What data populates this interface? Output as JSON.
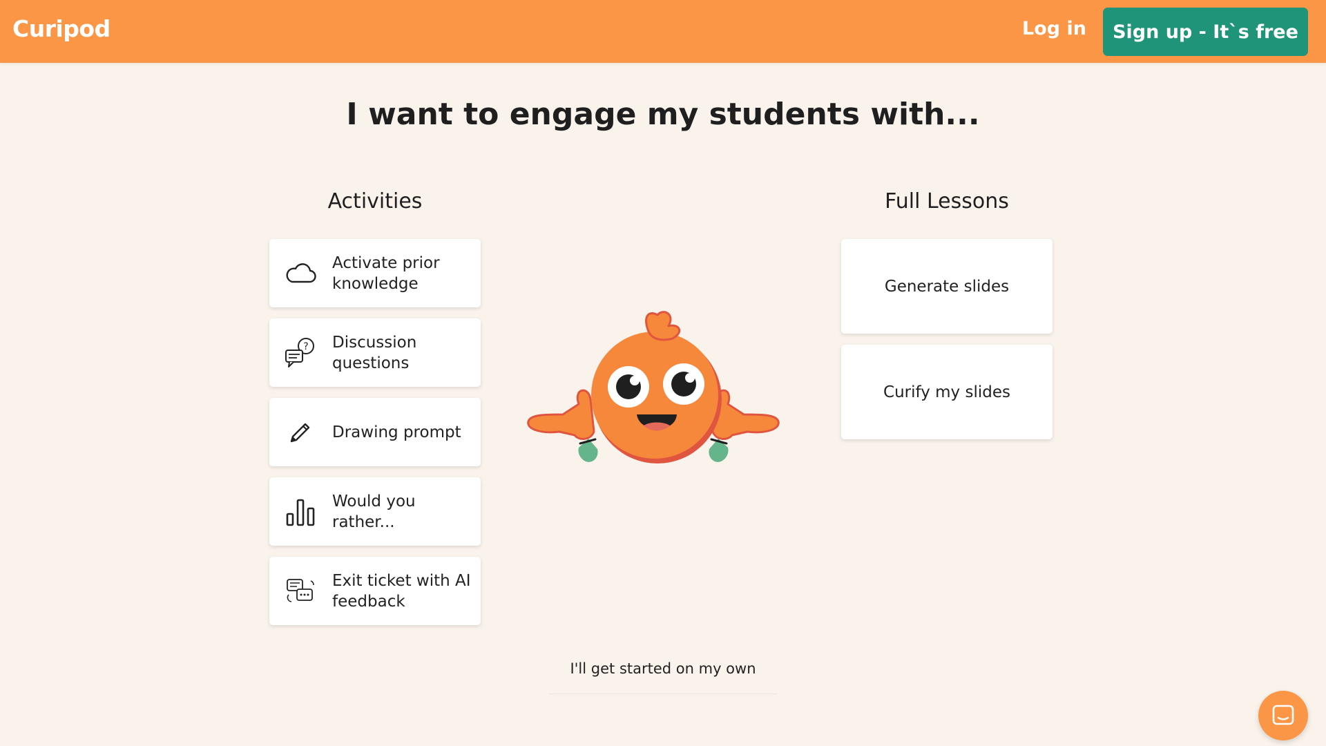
{
  "header": {
    "logo_text": "Curipod",
    "login_label": "Log in",
    "signup_label": "Sign up - It`s free",
    "colors": {
      "bar": "#fa9646",
      "signup": "#1f9478"
    }
  },
  "headline": {
    "prefix": "I want to ",
    "emphasis": "engage my students",
    "suffix": " with..."
  },
  "activities": {
    "title": "Activities",
    "items": [
      {
        "label": "Activate prior knowledge",
        "icon": "cloud-icon"
      },
      {
        "label": "Discussion questions",
        "icon": "discussion-icon"
      },
      {
        "label": "Drawing prompt",
        "icon": "pencil-icon"
      },
      {
        "label": "Would you rather...",
        "icon": "bar-chart-icon"
      },
      {
        "label": "Exit ticket with AI feedback",
        "icon": "chat-feedback-icon"
      }
    ]
  },
  "lessons": {
    "title": "Full Lessons",
    "items": [
      {
        "label": "Generate slides"
      },
      {
        "label": "Curify my slides"
      }
    ]
  },
  "footer": {
    "own_label": "I'll get started on my own"
  },
  "chat_widget": {
    "icon": "chat-bubble-icon"
  }
}
